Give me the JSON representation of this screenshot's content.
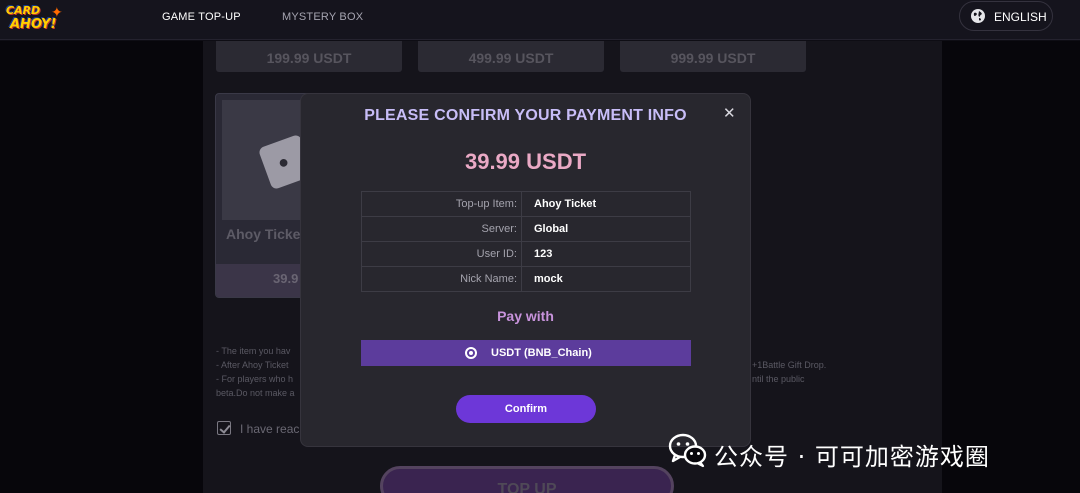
{
  "header": {
    "logo_line1": "CARD",
    "logo_line2": "AHOY!",
    "nav": [
      "GAME TOP-UP",
      "MYSTERY BOX"
    ],
    "language": "ENGLISH",
    "language_icon": "globe-icon"
  },
  "page": {
    "price_cards": [
      "199.99 USDT",
      "499.99 USDT",
      "999.99 USDT"
    ],
    "item_card": {
      "name": "Ahoy Ticke",
      "price": "39.9"
    },
    "notes": [
      "- The item you hav",
      "- After Ahoy Ticket",
      "- For players who h",
      "beta.Do not make a"
    ],
    "notes_right": [
      "+1Battle Gift Drop.",
      "ntil the public"
    ],
    "agree_text": "I have reac",
    "topup_label": "TOP UP"
  },
  "modal": {
    "title": "PLEASE CONFIRM YOUR PAYMENT INFO",
    "close_icon": "close-icon",
    "amount": "39.99 USDT",
    "rows": [
      {
        "label": "Top-up Item:",
        "value": "Ahoy Ticket"
      },
      {
        "label": "Server:",
        "value": "Global"
      },
      {
        "label": "User ID:",
        "value": "123"
      },
      {
        "label": "Nick Name:",
        "value": "mock"
      }
    ],
    "pay_with": "Pay with",
    "pay_option": "USDT (BNB_Chain)",
    "confirm_label": "Confirm"
  },
  "watermark": {
    "text": "公众号 · 可可加密游戏圈",
    "icon": "wechat-icon"
  },
  "colors": {
    "accent_purple": "#6d37d8",
    "modal_title": "#c8bdf7",
    "amount_pink": "#eaa9c5",
    "pay_with": "#c893dc",
    "selected_option": "#5c3c9c"
  }
}
